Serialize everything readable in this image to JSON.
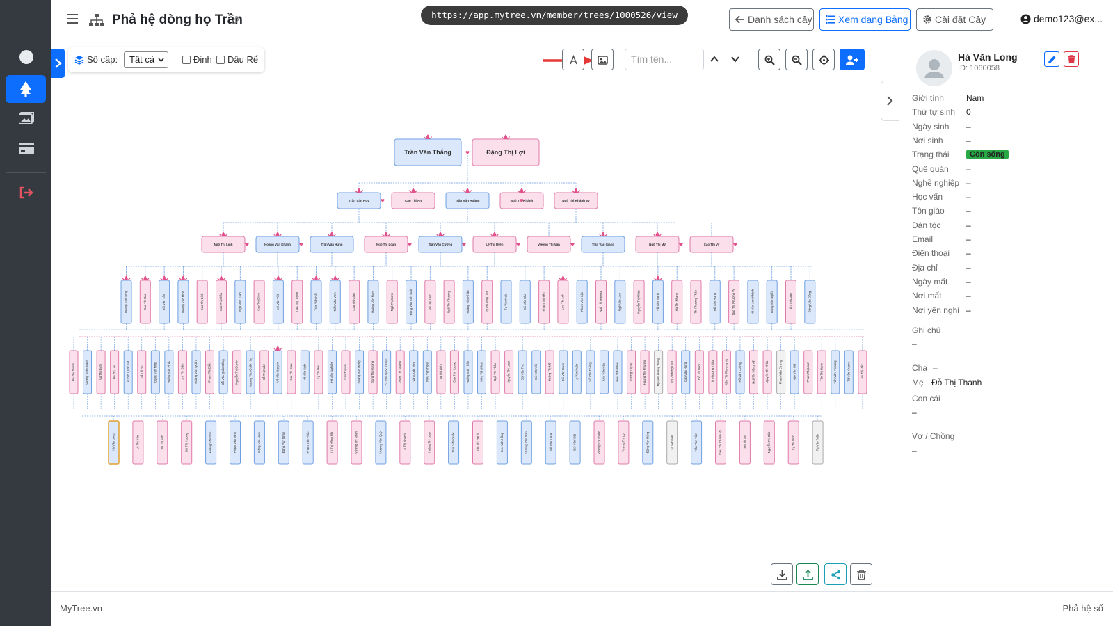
{
  "header": {
    "title": "Phả hệ dòng họ Trần",
    "url": "https://app.mytree.vn/member/trees/1000526/view",
    "buttons": {
      "list": "Danh sách cây",
      "table": "Xem dạng Bảng",
      "settings": "Cài đặt Cây"
    },
    "user": "demo123@ex..."
  },
  "toolbar": {
    "level_label": "Số cấp:",
    "level_value": "Tất cả",
    "pin_label": "Đinh",
    "inlaw_label": "Dâu Rể",
    "search_placeholder": "Tìm tên..."
  },
  "tree": {
    "gen1": [
      {
        "name": "Trần Văn Thắng",
        "sex": "m"
      },
      {
        "name": "Đặng Thị Lợi",
        "sex": "f"
      }
    ],
    "gen2": [
      {
        "name": "Trần Văn Huy",
        "sex": "m"
      },
      {
        "name": "Cao Thị An",
        "sex": "f"
      },
      {
        "name": "Trần Văn Hoàng",
        "sex": "m"
      },
      {
        "name": "Ngô Thị Khánh",
        "sex": "f"
      },
      {
        "name": "Ngô Thị Khánh Vy",
        "sex": "f"
      }
    ],
    "gen3": [
      {
        "name": "Ngô Thị Linh",
        "sex": "f"
      },
      {
        "name": "Hoàng Văn Khánh",
        "sex": "m"
      },
      {
        "name": "Trần Văn Hùng",
        "sex": "m"
      },
      {
        "name": "Ngô Thị Loan",
        "sex": "f"
      },
      {
        "name": "Trần Văn Cường",
        "sex": "m"
      },
      {
        "name": "Lê Thị Uyên",
        "sex": "f"
      },
      {
        "name": "Vương Thị Vân",
        "sex": "f"
      },
      {
        "name": "Trần Văn Giang",
        "sex": "m"
      },
      {
        "name": "Ngô Thị Mỹ",
        "sex": "f"
      },
      {
        "name": "Cao Thị Vy",
        "sex": "f"
      }
    ],
    "gen4": [
      {
        "name": "Hoàng Văn Long",
        "sex": "m"
      },
      {
        "name": "Cao Thị Bảo",
        "sex": "f"
      },
      {
        "name": "Bùi Văn Tâm",
        "sex": "m"
      },
      {
        "name": "Hoàng Văn Minh",
        "sex": "m"
      },
      {
        "name": "Cao Thị Bích",
        "sex": "f"
      },
      {
        "name": "Cao Thị Châu",
        "sex": "f"
      },
      {
        "name": "Ngô Văn Tuấn",
        "sex": "m"
      },
      {
        "name": "Cao Thị Diễm",
        "sex": "f"
      },
      {
        "name": "Võ Văn Việt",
        "sex": "m"
      },
      {
        "name": "Cao Thị Duyên",
        "sex": "f"
      },
      {
        "name": "Trần Văn Hải",
        "sex": "m"
      },
      {
        "name": "Trần Văn Vinh",
        "sex": "m"
      },
      {
        "name": "Cao Thị Giao",
        "sex": "f"
      },
      {
        "name": "Hoàng Văn Nam",
        "sex": "m"
      },
      {
        "name": "Ngô Thị Oanh",
        "sex": "f"
      },
      {
        "name": "Đặng Văn Anh Tuấn",
        "sex": "m"
      },
      {
        "name": "Vũ Thị Xuân",
        "sex": "f"
      },
      {
        "name": "Ngô Thị Phương",
        "sex": "f"
      },
      {
        "name": "Hoàng Văn Nhân",
        "sex": "m"
      },
      {
        "name": "Thị Phương Liên",
        "sex": "f"
      },
      {
        "name": "Tạ Văn Hoài",
        "sex": "m"
      },
      {
        "name": "Bùi Văn Kha",
        "sex": "m"
      },
      {
        "name": "Phạm Thị Yến",
        "sex": "f"
      },
      {
        "name": "Lưu Thị Anh",
        "sex": "f"
      },
      {
        "name": "Phạm Văn Lộc",
        "sex": "m"
      },
      {
        "name": "Ngô Thị Hương",
        "sex": "f"
      },
      {
        "name": "Ngô Văn Lâm",
        "sex": "m"
      },
      {
        "name": "Nguyễn Thị Nhàn",
        "sex": "f"
      },
      {
        "name": "Võ Văn Mạnh",
        "sex": "m"
      },
      {
        "name": "Hà Thị Nhanh",
        "sex": "f"
      },
      {
        "name": "Thị Phương Thảo",
        "sex": "f"
      },
      {
        "name": "Hồ Văn Hưng",
        "sex": "m"
      },
      {
        "name": "Ngô Thị Phương Vy",
        "sex": "f"
      },
      {
        "name": "Hồ Văn Anh Khánh",
        "sex": "m"
      },
      {
        "name": "Đặng Văn Nghĩa",
        "sex": "m"
      },
      {
        "name": "Tôn Thị Loan",
        "sex": "f"
      },
      {
        "name": "Đặng Văn Dũng",
        "sex": "m"
      }
    ],
    "gen5": [
      {
        "name": "Đỗ Thị Thanh",
        "sex": "f"
      },
      {
        "name": "Vương Văn Quách",
        "sex": "m"
      },
      {
        "name": "Vũ Thị Bích",
        "sex": "f"
      },
      {
        "name": "Đỗ Thị Lợi",
        "sex": "f"
      },
      {
        "name": "Lê Văn Quốc Cơ",
        "sex": "m"
      },
      {
        "name": "Đỗ Thị An",
        "sex": "f"
      },
      {
        "name": "Đặng Văn Nhật",
        "sex": "m"
      },
      {
        "name": "Hoàng Văn Phúc",
        "sex": "m"
      },
      {
        "name": "Lưu Thị Diệu",
        "sex": "f"
      },
      {
        "name": "Hoàng Văn Quân",
        "sex": "m"
      },
      {
        "name": "Phạm Thị Diễm",
        "sex": "f"
      },
      {
        "name": "Đỗ Văn Quốc Đông",
        "sex": "m"
      },
      {
        "name": "Nguyễn Thị Duyên",
        "sex": "f"
      },
      {
        "name": "Vương Văn Quốc Huy",
        "sex": "m"
      },
      {
        "name": "Đỗ Thị Xuân",
        "sex": "f"
      },
      {
        "name": "Võ Văn Nguyên",
        "sex": "m"
      },
      {
        "name": "Cao Thị Giao",
        "sex": "f"
      },
      {
        "name": "Hồ Văn Nghị",
        "sex": "m"
      },
      {
        "name": "Lý Thị Hồi",
        "sex": "f"
      },
      {
        "name": "Hồ Văn Nghiêm",
        "sex": "m"
      },
      {
        "name": "Cao Thị Hà",
        "sex": "f"
      },
      {
        "name": "Hoàng Văn Hồng",
        "sex": "m"
      },
      {
        "name": "Đặng Thị Hương",
        "sex": "f"
      },
      {
        "name": "Tạ Văn Quốc Khánh",
        "sex": "m"
      },
      {
        "name": "Phạm Thị Khánh",
        "sex": "f"
      },
      {
        "name": "Văn Quốc Việt",
        "sex": "m"
      },
      {
        "name": "Kiều Văn Hoài",
        "sex": "m"
      },
      {
        "name": "Tạ Thị Linh",
        "sex": "f"
      },
      {
        "name": "Cao Thị Hương",
        "sex": "f"
      },
      {
        "name": "Hoàng Văn Thân",
        "sex": "m"
      },
      {
        "name": "Kiều Văn Khải",
        "sex": "m"
      },
      {
        "name": "Ngô Thị Thảo",
        "sex": "f"
      },
      {
        "name": "Nguyễn Thị Loan",
        "sex": "f"
      },
      {
        "name": "Bùi Văn Thu",
        "sex": "m"
      },
      {
        "name": "Bùi Văn Vũ",
        "sex": "m"
      },
      {
        "name": "Hoàng Thị Mỹ",
        "sex": "f"
      },
      {
        "name": "Bùi Văn Danh",
        "sex": "m"
      },
      {
        "name": "Lý Văn Xuân",
        "sex": "m"
      },
      {
        "name": "Vũ Văn Thắng",
        "sex": "m"
      },
      {
        "name": "Kiều Văn Hậu",
        "sex": "m"
      },
      {
        "name": "Kiều Văn Khôi",
        "sex": "m"
      },
      {
        "name": "Vương Thị Vy",
        "sex": "f"
      },
      {
        "name": "Hoàng Thị Phương",
        "sex": "f"
      },
      {
        "name": "Nguyễn Hoàng Trung",
        "sex": "n"
      },
      {
        "name": "Thị Phương Liên",
        "sex": "f"
      },
      {
        "name": "Cao Văn Hùng",
        "sex": "m"
      },
      {
        "name": "Đỗ Thị Bảo",
        "sex": "f"
      },
      {
        "name": "Thị Phương Thảo",
        "sex": "f"
      },
      {
        "name": "Kiều Thị Phương Vy",
        "sex": "f"
      },
      {
        "name": "Hồ Văn Cường",
        "sex": "m"
      },
      {
        "name": "Ngô Thị Hồng Mỹ",
        "sex": "f"
      },
      {
        "name": "Nguyễn Thị Thảo",
        "sex": "f"
      },
      {
        "name": "Phạm Văn Cương",
        "sex": "n"
      },
      {
        "name": "Ngô Văn Hải",
        "sex": "m"
      },
      {
        "name": "Phạm Thị Loan",
        "sex": "f"
      },
      {
        "name": "Tôn Thị Hạnh",
        "sex": "f"
      },
      {
        "name": "Tôn Văn Phương",
        "sex": "m"
      },
      {
        "name": "Tô Văn Khánh",
        "sex": "m"
      },
      {
        "name": "Lưu Thị Vân",
        "sex": "f"
      }
    ],
    "gen6": [
      {
        "name": "Hà Văn Long",
        "sex": "m",
        "selected": true
      },
      {
        "name": "Lê Thị Yến",
        "sex": "f"
      },
      {
        "name": "Vũ Thị Anh",
        "sex": "f"
      },
      {
        "name": "Bùi Thị Hương",
        "sex": "f"
      },
      {
        "name": "Hoàng Văn Sơn",
        "sex": "m"
      },
      {
        "name": "Phạm Văn Minh",
        "sex": "m"
      },
      {
        "name": "Đặng Văn Nam",
        "sex": "m"
      },
      {
        "name": "Đặng Văn Nhân",
        "sex": "m"
      },
      {
        "name": "Phạm Văn Phúc",
        "sex": "m"
      },
      {
        "name": "Lý Thị Hồng Nhi",
        "sex": "f"
      },
      {
        "name": "Vương Thị Nhàn",
        "sex": "f"
      },
      {
        "name": "Vương Văn Quý",
        "sex": "m"
      },
      {
        "name": "Lê Thị Nhanh",
        "sex": "f"
      },
      {
        "name": "Hoàng Thị Loan",
        "sex": "f"
      },
      {
        "name": "Trần Văn Quốc",
        "sex": "m"
      },
      {
        "name": "Tôn Thị Hạnh",
        "sex": "f"
      },
      {
        "name": "Lưu Văn Hồng",
        "sex": "m"
      },
      {
        "name": "Vương Văn Sơn",
        "sex": "m"
      },
      {
        "name": "Bùi Văn Tùng",
        "sex": "m"
      },
      {
        "name": "Bùi Văn Việt",
        "sex": "m"
      },
      {
        "name": "Vương Thị Thanh",
        "sex": "f"
      },
      {
        "name": "Vương Thị Lợi",
        "sex": "f"
      },
      {
        "name": "Đặng Văn Hùng",
        "sex": "m"
      },
      {
        "name": "Tạ Văn Việt",
        "sex": "n"
      },
      {
        "name": "Trần Văn Tâm",
        "sex": "m"
      },
      {
        "name": "Kiều Thị Khánh Vy",
        "sex": "f"
      },
      {
        "name": "Tôn Thị An",
        "sex": "f"
      },
      {
        "name": "Nguyễn Thị Bảo",
        "sex": "f"
      },
      {
        "name": "Lý Thị Bích",
        "sex": "f"
      },
      {
        "name": "Tạ Văn Tuấn",
        "sex": "n"
      }
    ]
  },
  "panel": {
    "name": "Hà Văn Long",
    "id": "ID: 1060058",
    "fields": [
      {
        "k": "Giới tính",
        "v": "Nam"
      },
      {
        "k": "Thứ tự sinh",
        "v": "0"
      },
      {
        "k": "Ngày sinh",
        "v": "–"
      },
      {
        "k": "Nơi sinh",
        "v": "–"
      },
      {
        "k": "Trạng thái",
        "v": "Còn sống",
        "badge": true
      },
      {
        "k": "Quê quán",
        "v": "–"
      },
      {
        "k": "Nghề nghiệp",
        "v": "–"
      },
      {
        "k": "Học vấn",
        "v": "–"
      },
      {
        "k": "Tôn giáo",
        "v": "–"
      },
      {
        "k": "Dân tộc",
        "v": "–"
      },
      {
        "k": "Email",
        "v": "–"
      },
      {
        "k": "Điện thoại",
        "v": "–"
      },
      {
        "k": "Địa chỉ",
        "v": "–"
      },
      {
        "k": "Ngày mất",
        "v": "–"
      },
      {
        "k": "Nơi mất",
        "v": "–"
      },
      {
        "k": "Nơi yên nghỉ",
        "v": "–"
      }
    ],
    "note_label": "Ghi chú",
    "note_value": "–",
    "father_label": "Cha",
    "father_value": "–",
    "mother_label": "Mẹ",
    "mother_value": "Đỗ Thị Thanh",
    "children_label": "Con cái",
    "children_value": "–",
    "spouse_label": "Vợ / Chồng",
    "spouse_value": "–"
  },
  "footer": {
    "left": "MyTree.vn",
    "right": "Phả hệ số"
  },
  "colors": {
    "accent": "#0d6efd",
    "sidebar": "#343a40",
    "male_fill": "#dbe8fb",
    "male_border": "#6f9fe0",
    "female_fill": "#fbe0ec",
    "female_border": "#e07aa8",
    "neutral_fill": "#f1f1f1",
    "neutral_border": "#aaaaaa",
    "lotus": "#e0508a",
    "alive_badge": "#28a745",
    "danger": "#dc3545",
    "success": "#198754",
    "teal": "#1a9fb5"
  }
}
